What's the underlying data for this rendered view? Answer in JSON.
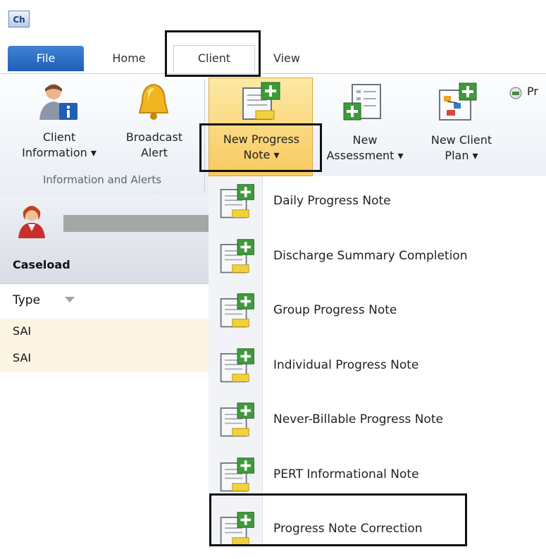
{
  "app": {
    "icon_text": "Ch"
  },
  "tabs": [
    {
      "label": "File"
    },
    {
      "label": "Home"
    },
    {
      "label": "Client"
    },
    {
      "label": "View"
    }
  ],
  "ribbon": {
    "client_information": {
      "line1": "Client",
      "line2": "Information ▾"
    },
    "broadcast_alert": {
      "line1": "Broadcast",
      "line2": "Alert"
    },
    "new_progress_note": {
      "line1": "New Progress",
      "line2": "Note ▾"
    },
    "new_assessment": {
      "line1": "New",
      "line2": "Assessment ▾"
    },
    "new_client_plan": {
      "line1": "New Client",
      "line2": "Plan ▾"
    },
    "partial_button": {
      "label": "Pr"
    },
    "group_caption": "Information and Alerts"
  },
  "left_pane": {
    "caseload_label": "Caseload",
    "type_header": "Type",
    "rows": [
      "SAI",
      "SAI"
    ]
  },
  "dropdown": {
    "items": [
      {
        "label": "Daily Progress Note"
      },
      {
        "label": "Discharge Summary Completion"
      },
      {
        "label": "Group Progress Note"
      },
      {
        "label": "Individual Progress Note"
      },
      {
        "label": "Never-Billable Progress Note"
      },
      {
        "label": "PERT Informational Note"
      },
      {
        "label": "Progress Note Correction"
      }
    ]
  },
  "colors": {
    "accent": "#1f5fb5",
    "highlight": "#f8c95e",
    "icon_green": "#3f9b3a"
  }
}
